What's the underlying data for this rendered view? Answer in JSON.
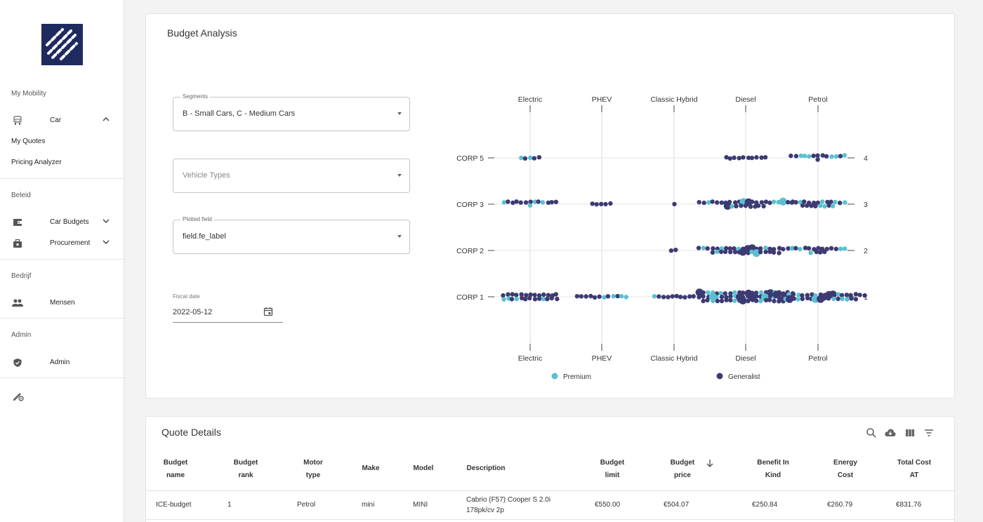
{
  "sidebar": {
    "sections": {
      "my_mobility": "My Mobility",
      "beleid": "Beleid",
      "bedrijf": "Bedrijf",
      "admin": "Admin"
    },
    "items": {
      "car": "Car",
      "my_quotes": "My Quotes",
      "pricing_analyzer": "Pricing Analyzer",
      "car_budgets": "Car Budgets",
      "procurement": "Procurement",
      "mensen": "Mensen",
      "admin": "Admin"
    }
  },
  "budget_analysis": {
    "title": "Budget Analysis",
    "segments": {
      "label": "Segments",
      "value": "B - Small Cars, C - Medium Cars"
    },
    "vehicle_types": {
      "placeholder": "Vehicle Types"
    },
    "plotted_field": {
      "label": "Plotted field",
      "value": "field.fe_label"
    },
    "fiscal_date": {
      "label": "Fiscal date",
      "value": "2022-05-12"
    }
  },
  "chart_data": {
    "type": "scatter",
    "title": "",
    "categories": [
      "Electric",
      "PHEV",
      "Classic Hybrid",
      "Diesel",
      "Petrol"
    ],
    "rows": [
      "CORP 5",
      "CORP 3",
      "CORP 2",
      "CORP 1"
    ],
    "right_labels": [
      "4",
      "3",
      "2",
      "1"
    ],
    "legend": [
      "Premium",
      "Generalist"
    ],
    "legend_position": "bottom",
    "colors": {
      "Premium": "#5bc0d0",
      "Generalist": "#3d3a73"
    },
    "series": [
      {
        "row": "CORP 5",
        "category": "Electric",
        "premium": 2,
        "generalist": 3
      },
      {
        "row": "CORP 5",
        "category": "Diesel",
        "premium": 0,
        "generalist": 10
      },
      {
        "row": "CORP 5",
        "category": "Petrol",
        "premium": 6,
        "generalist": 8
      },
      {
        "row": "CORP 3",
        "category": "Electric",
        "premium": 4,
        "generalist": 10
      },
      {
        "row": "CORP 3",
        "category": "PHEV",
        "premium": 0,
        "generalist": 5
      },
      {
        "row": "CORP 3",
        "category": "Classic Hybrid",
        "premium": 0,
        "generalist": 1
      },
      {
        "row": "CORP 3",
        "category": "Diesel",
        "premium": 6,
        "generalist": 25
      },
      {
        "row": "CORP 3",
        "category": "Petrol",
        "premium": 7,
        "generalist": 14
      },
      {
        "row": "CORP 2",
        "category": "Classic Hybrid",
        "premium": 0,
        "generalist": 2
      },
      {
        "row": "CORP 2",
        "category": "Diesel",
        "premium": 8,
        "generalist": 30
      },
      {
        "row": "CORP 2",
        "category": "Petrol",
        "premium": 5,
        "generalist": 12
      },
      {
        "row": "CORP 1",
        "category": "Electric",
        "premium": 4,
        "generalist": 22
      },
      {
        "row": "CORP 1",
        "category": "PHEV",
        "premium": 4,
        "generalist": 8
      },
      {
        "row": "CORP 1",
        "category": "Classic Hybrid",
        "premium": 1,
        "generalist": 9
      },
      {
        "row": "CORP 1",
        "category": "Diesel",
        "premium": 14,
        "generalist": 50
      },
      {
        "row": "CORP 1",
        "category": "Petrol",
        "premium": 10,
        "generalist": 30
      }
    ]
  },
  "quote_details": {
    "title": "Quote Details",
    "columns": [
      {
        "l1": "Budget",
        "l2": "name"
      },
      {
        "l1": "Budget",
        "l2": "rank"
      },
      {
        "l1": "Motor",
        "l2": "type"
      },
      {
        "l1": "Make",
        "l2": ""
      },
      {
        "l1": "Model",
        "l2": ""
      },
      {
        "l1": "Description",
        "l2": ""
      },
      {
        "l1": "Budget",
        "l2": "limit"
      },
      {
        "l1": "Budget",
        "l2": "price"
      },
      {
        "l1": "Benefit In",
        "l2": "Kind"
      },
      {
        "l1": "Energy",
        "l2": "Cost"
      },
      {
        "l1": "Total Cost",
        "l2": "AT"
      }
    ],
    "rows": [
      {
        "budget_name": "ICE-budget",
        "budget_rank": "1",
        "motor_type": "Petrol",
        "make": "mini",
        "model": "MINI",
        "description_l1": "Cabrio (F57) Cooper S 2.0i",
        "description_l2": "178pk/cv 2p",
        "budget_limit": "€550.00",
        "budget_price": "€504.07",
        "benefit_in_kind": "€250.84",
        "energy_cost": "€260.79",
        "total_cost": "€831.76"
      }
    ]
  }
}
